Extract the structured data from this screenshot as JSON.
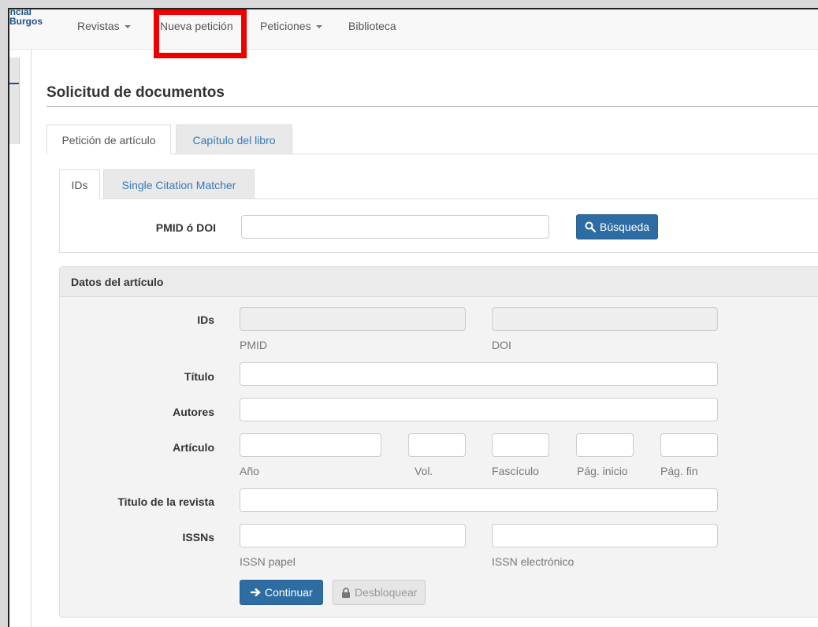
{
  "brand": {
    "line1": "encial",
    "line2": "Burgos"
  },
  "nav": {
    "items": [
      {
        "label": "Revistas",
        "has_caret": true
      },
      {
        "label": "Nueva petición",
        "has_caret": false
      },
      {
        "label": "Peticiones",
        "has_caret": true
      },
      {
        "label": "Biblioteca",
        "has_caret": false
      }
    ]
  },
  "page": {
    "title": "Solicitud de documentos"
  },
  "tabs": [
    {
      "label": "Petición de artículo",
      "active": true
    },
    {
      "label": "Capítulo del libro",
      "active": false
    }
  ],
  "subtabs": [
    {
      "label": "IDs",
      "active": true
    },
    {
      "label": "Single Citation Matcher",
      "active": false
    }
  ],
  "search": {
    "label": "PMID ó DOI",
    "value": "",
    "button_label": "Búsqueda",
    "button_icon": "search-icon"
  },
  "panel": {
    "title": "Datos del artículo",
    "ids": {
      "label": "IDs",
      "pmid_help": "PMID",
      "doi_help": "DOI",
      "pmid_value": "",
      "doi_value": ""
    },
    "titulo": {
      "label": "Título",
      "value": ""
    },
    "autores": {
      "label": "Autores",
      "value": ""
    },
    "articulo": {
      "label": "Artículo",
      "anio_help": "Año",
      "vol_help": "Vol.",
      "fasciculo_help": "Fascículo",
      "pag_inicio_help": "Pág. inicio",
      "pag_fin_help": "Pág. fin"
    },
    "revista": {
      "label": "Titulo de la revista",
      "value": ""
    },
    "issns": {
      "label": "ISSNs",
      "papel_help": "ISSN papel",
      "electronico_help": "ISSN electrónico"
    },
    "continue_label": "Continuar",
    "unlock_label": "Desbloquear"
  },
  "colors": {
    "primary": "#2e6da4",
    "link": "#337ab7",
    "highlight": "#ee0000"
  }
}
